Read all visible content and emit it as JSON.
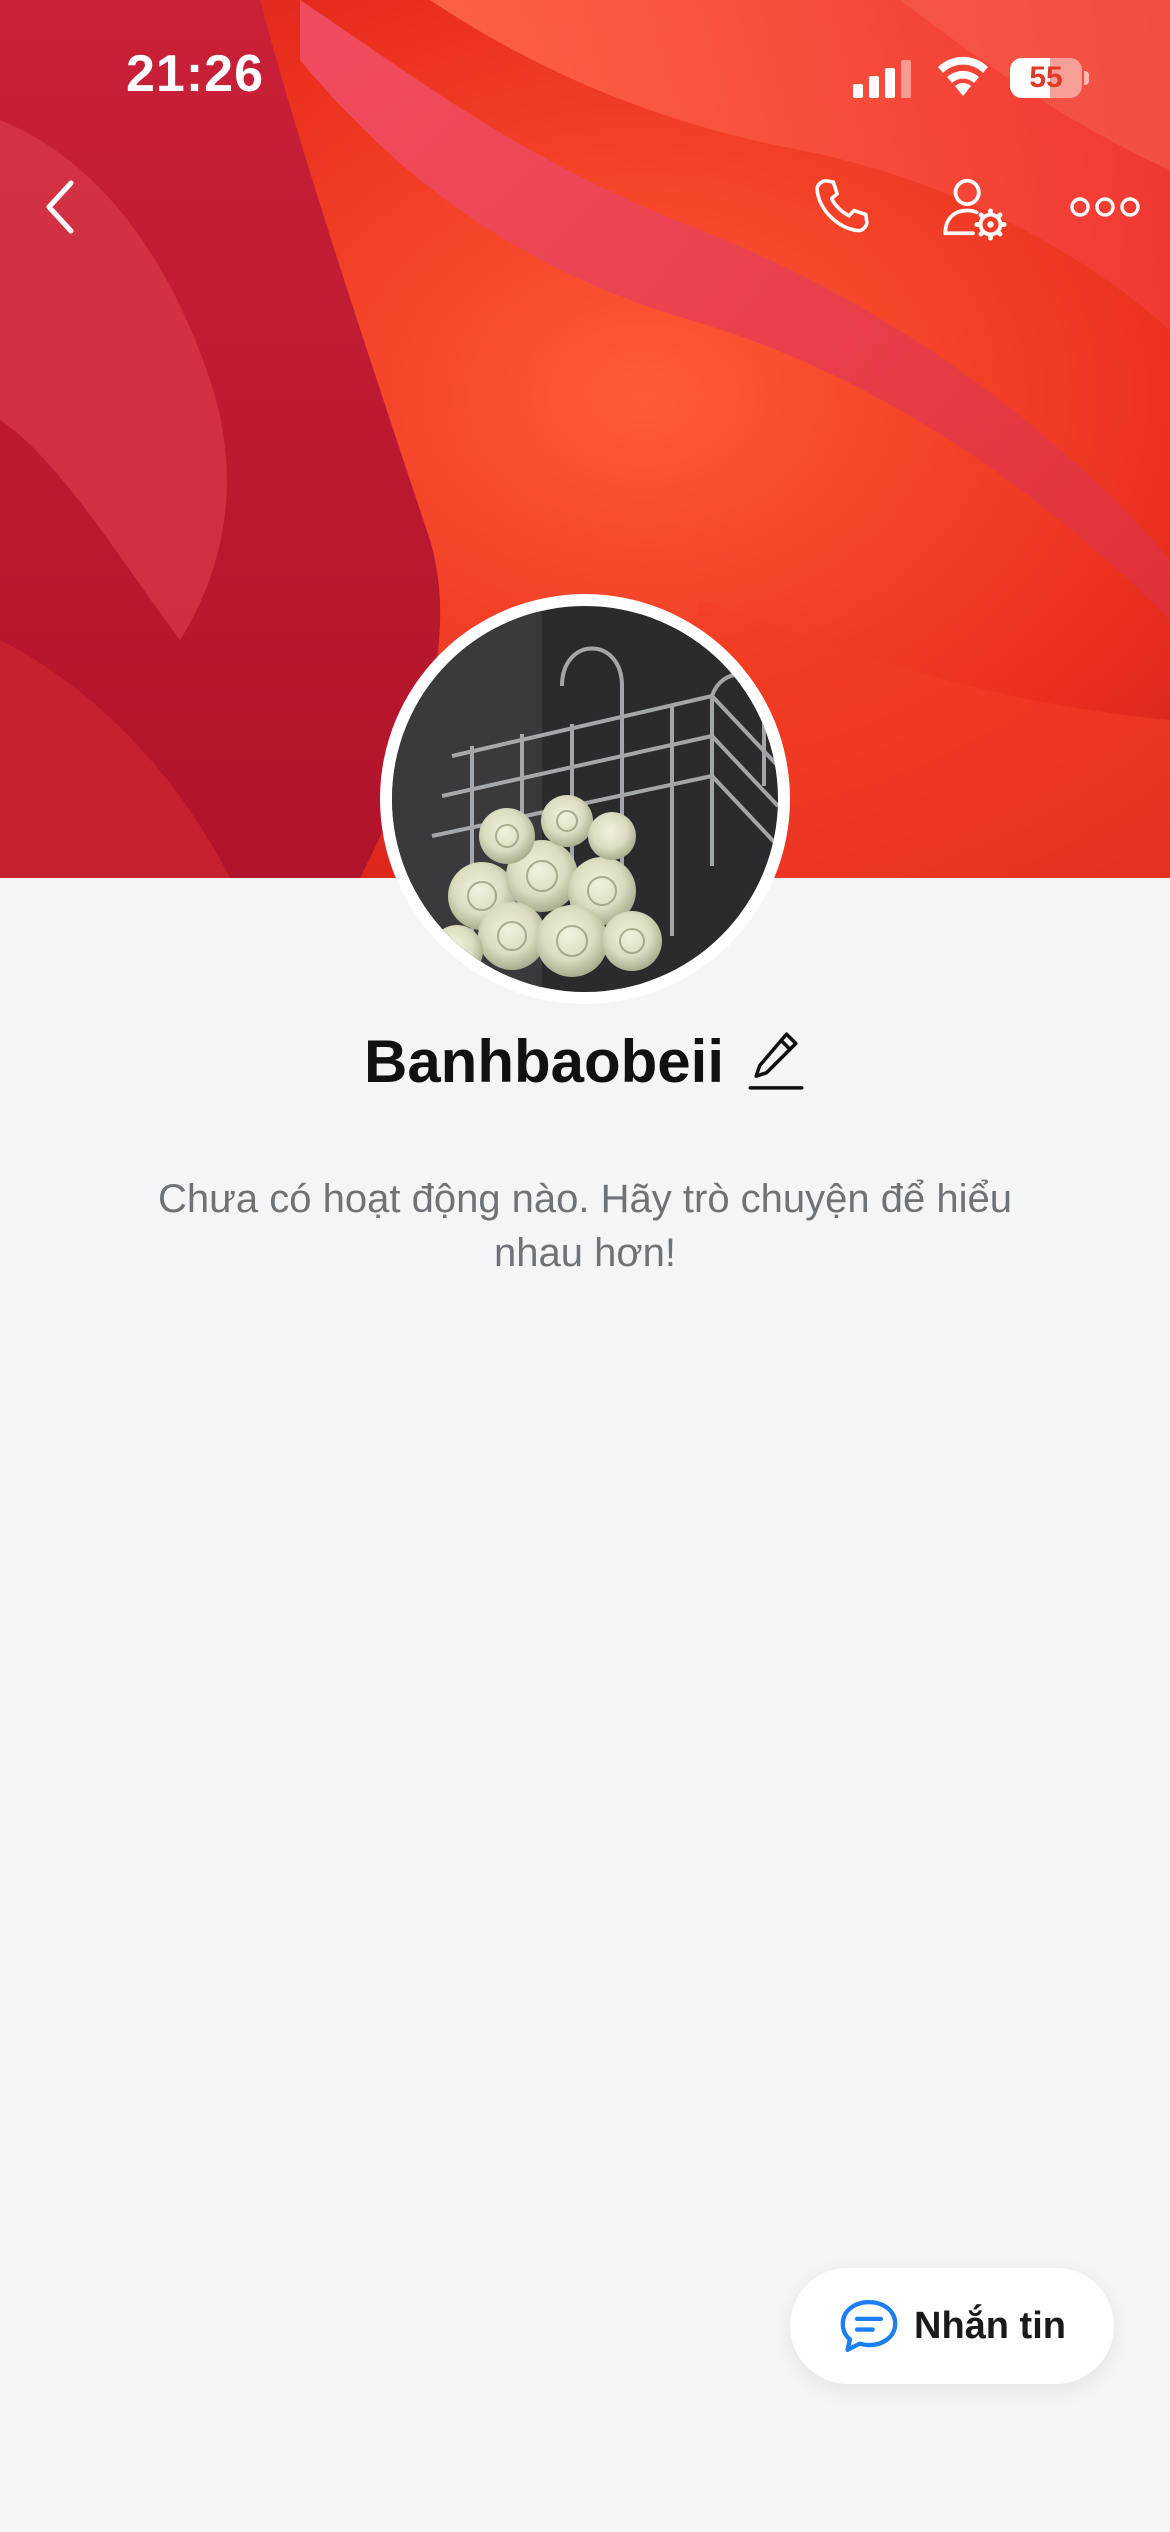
{
  "status_bar": {
    "time": "21:26",
    "battery_text": "55",
    "battery_level": 0.55,
    "signal_icon": "cellular-signal-icon",
    "wifi_icon": "wifi-icon"
  },
  "nav": {
    "back_icon": "chevron-left-icon",
    "call_icon": "phone-icon",
    "settings_icon": "user-gear-icon",
    "more_icon": "more-horizontal-icon"
  },
  "profile": {
    "name": "Banhbaobeii",
    "edit_icon": "pencil-icon",
    "empty_message": "Chưa có hoạt động nào. Hãy trò chuyện để hiểu nhau hơn!"
  },
  "actions": {
    "message_label": "Nhắn tin",
    "message_icon": "chat-bubble-icon"
  },
  "colors": {
    "accent": "#1b7ef2",
    "background": "#f4f5f7",
    "cover": "#e6321f"
  }
}
